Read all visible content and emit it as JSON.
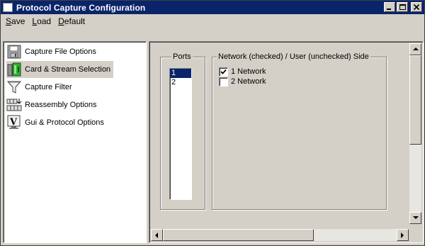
{
  "window": {
    "title": "Protocol Capture Configuration"
  },
  "menu": [
    {
      "label": "Save",
      "mnemonic": "S",
      "rest": "ave"
    },
    {
      "label": "Load",
      "mnemonic": "L",
      "rest": "oad"
    },
    {
      "label": "Default",
      "mnemonic": "D",
      "rest": "efault"
    }
  ],
  "tree": {
    "items": [
      {
        "label": "Capture File Options",
        "icon": "floppy-disk-icon"
      },
      {
        "label": "Card & Stream Selection",
        "icon": "card-green-icon",
        "selected": true
      },
      {
        "label": "Capture Filter",
        "icon": "funnel-filter-icon"
      },
      {
        "label": "Reassembly Options",
        "icon": "reassembly-grid-icon"
      },
      {
        "label": "Gui & Protocol Options",
        "icon": "v-monitor-icon"
      }
    ]
  },
  "ports": {
    "label": "Ports",
    "items": [
      "1",
      "2"
    ],
    "selected": "1"
  },
  "network": {
    "label": "Network (checked) / User (unchecked) Side",
    "items": [
      {
        "label": "1 Network",
        "checked": true
      },
      {
        "label": "2 Network",
        "checked": false
      }
    ]
  },
  "colors": {
    "titlebar": "#0a246a",
    "face": "#d4d0c8",
    "selection": "#0a246a"
  }
}
